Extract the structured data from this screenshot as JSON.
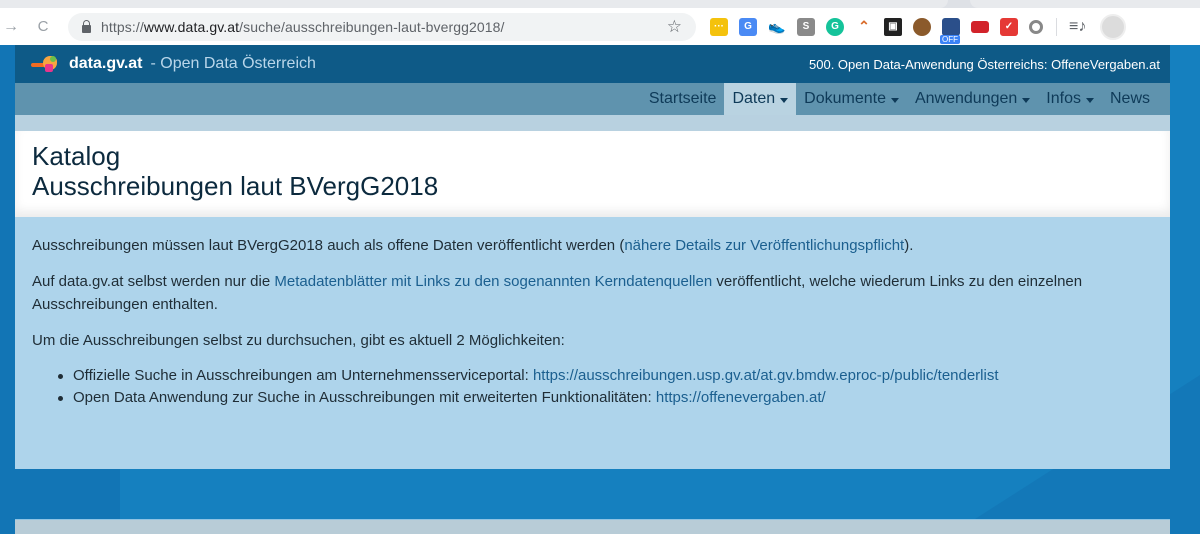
{
  "browser": {
    "url_prefix": "https://",
    "url_host": "www.data.gv.at",
    "url_path": "/suche/ausschreibungen-laut-bvergg2018/",
    "icons": {
      "forward": "→",
      "reload": "C",
      "bookmark": "☆",
      "media": "≡♪"
    },
    "extensions": [
      {
        "name": "extension-1",
        "glyph": "···"
      },
      {
        "name": "google-translate",
        "glyph": "G"
      },
      {
        "name": "extension-sneaker",
        "glyph": "👟"
      },
      {
        "name": "extension-s",
        "glyph": "S"
      },
      {
        "name": "grammarly",
        "glyph": "G"
      },
      {
        "name": "extension-arc",
        "glyph": "⌃"
      },
      {
        "name": "extension-archive",
        "glyph": "▣"
      },
      {
        "name": "extension-cookie",
        "glyph": ""
      },
      {
        "name": "extension-off",
        "glyph": "",
        "badge": "OFF"
      },
      {
        "name": "extension-red",
        "glyph": "▪"
      },
      {
        "name": "extension-pocket",
        "glyph": "✓"
      },
      {
        "name": "extension-circle",
        "glyph": ""
      }
    ]
  },
  "header": {
    "brand": "data.gv.at",
    "tagline": "- Open Data Österreich",
    "announcement": "500. Open Data-Anwendung Österreichs: OffeneVergaben.at"
  },
  "nav": {
    "items": [
      {
        "label": "Startseite",
        "dropdown": false,
        "active": false
      },
      {
        "label": "Daten",
        "dropdown": true,
        "active": true
      },
      {
        "label": "Dokumente",
        "dropdown": true,
        "active": false
      },
      {
        "label": "Anwendungen",
        "dropdown": true,
        "active": false
      },
      {
        "label": "Infos",
        "dropdown": true,
        "active": false
      },
      {
        "label": "News",
        "dropdown": false,
        "active": false
      }
    ]
  },
  "title": {
    "line1": "Katalog",
    "line2": "Ausschreibungen laut BVergG2018"
  },
  "content": {
    "p1_before": "Ausschreibungen müssen laut BVergG2018 auch als offene Daten veröffentlicht werden (",
    "p1_link": "nähere Details zur Veröffentlichungspflicht",
    "p1_after": ").",
    "p2_before": "Auf data.gv.at selbst werden nur die ",
    "p2_link": "Metadatenblätter mit Links zu den sogenannten Kerndatenquellen",
    "p2_after": " veröffentlicht, welche wiederum Links zu den einzelnen Ausschreibungen enthalten.",
    "p3": "Um die Ausschreibungen selbst zu durchsuchen, gibt es aktuell 2 Möglichkeiten:",
    "list": [
      {
        "text": "Offizielle Suche in Ausschreibungen am Unternehmensserviceportal: ",
        "link": "https://ausschreibungen.usp.gv.at/at.gv.bmdw.eproc-p/public/tenderlist"
      },
      {
        "text": "Open Data Anwendung zur Suche in Ausschreibungen mit erweiterten Funktionalitäten: ",
        "link": "https://offenevergaben.at/"
      }
    ]
  },
  "colors": {
    "header_bg": "#0e5a87",
    "nav_bg": "#5f93ae",
    "nav_active_bg": "#b9d3e1",
    "content_bg": "#aed4eb",
    "page_bg": "#1580bf",
    "link": "#1b5f8f"
  }
}
